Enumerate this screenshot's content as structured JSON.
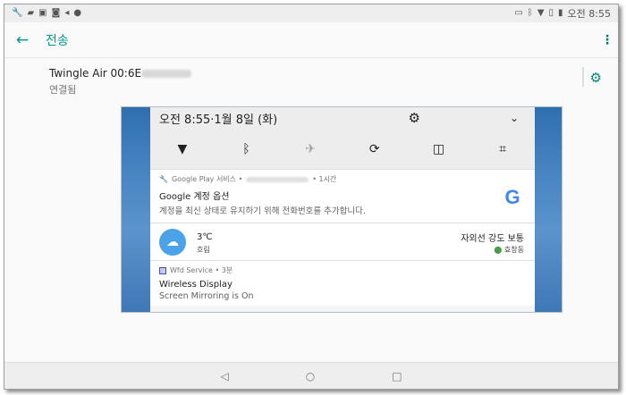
{
  "status_bar": {
    "left_icons": [
      "wrench-icon",
      "files-icon",
      "image-icon",
      "wfd-icon",
      "volume-icon",
      "dot-icon"
    ],
    "right_icons": [
      "cast-icon",
      "bluetooth-icon",
      "wifi-icon",
      "no-sim-icon",
      "battery-icon"
    ],
    "time": "오전 8:55"
  },
  "app_bar": {
    "title": "전송"
  },
  "device": {
    "name": "Twingle Air 00:6E",
    "status": "연결됨"
  },
  "mirror": {
    "quick_settings": {
      "datetime": "오전 8:55·1월 8일 (화)",
      "tiles": [
        {
          "name": "wifi",
          "glyph": "▼",
          "off": false
        },
        {
          "name": "bluetooth",
          "glyph": "ᛒ",
          "off": false
        },
        {
          "name": "airplane",
          "glyph": "✈",
          "off": true
        },
        {
          "name": "rotate",
          "glyph": "⟳",
          "off": false
        },
        {
          "name": "book",
          "glyph": "▯▯",
          "off": false
        },
        {
          "name": "crop",
          "glyph": "⌗",
          "off": false
        }
      ]
    },
    "google_notification": {
      "app": "Google Play 서비스 •",
      "time": "• 1시간",
      "title": "Google 계정 옵션",
      "body": "계정을 최신 상태로 유지하기 위해 전화번호를 추가합니다.",
      "logo": "G"
    },
    "weather": {
      "temp": "3℃",
      "desc": "흐림",
      "uv": "자외선 강도  보통",
      "location": "효창동"
    },
    "wfd_notification": {
      "app": "Wfd Service • 3분",
      "title": "Wireless Display",
      "body": "Screen Mirroring is On"
    }
  },
  "nav_bar": {
    "back": "◁",
    "home": "○",
    "recents": "□"
  }
}
